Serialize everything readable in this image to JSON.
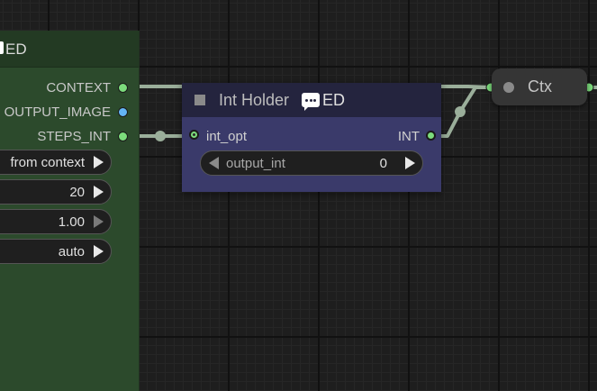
{
  "node_left": {
    "title": "ED",
    "outputs": [
      {
        "label": "CONTEXT",
        "color": "#7cdc7c"
      },
      {
        "label": "OUTPUT_IMAGE",
        "color": "#64b5f6"
      },
      {
        "label": "STEPS_INT",
        "color": "#7cdc7c"
      }
    ],
    "widgets": [
      {
        "value": "from context"
      },
      {
        "value": "20"
      },
      {
        "value": "1.00"
      },
      {
        "value": "auto"
      }
    ]
  },
  "node_int": {
    "title": "Int Holder",
    "title_suffix": "ED",
    "input_label": "int_opt",
    "output_label": "INT",
    "widget": {
      "name": "output_int",
      "value": "0"
    }
  },
  "node_ctx": {
    "title": "Ctx"
  },
  "colors": {
    "canvas": "#1e1e1e",
    "link": "#9aae9a",
    "node_left_body": "#2c4a2c",
    "node_int_body": "#3a3a6a",
    "slot_int": "#7cdc7c",
    "slot_image": "#64b5f6"
  },
  "icons": [
    "chat-bubble-icon",
    "collapse-square-icon"
  ]
}
